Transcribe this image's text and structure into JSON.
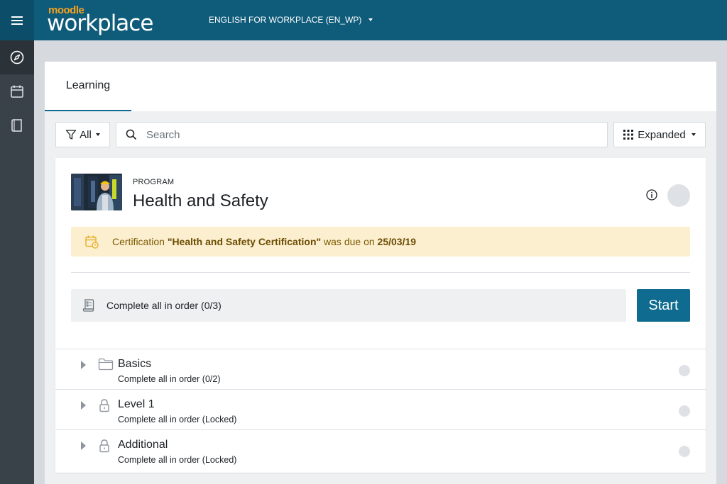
{
  "header": {
    "logo_small": "moodle",
    "logo_main": "workplace",
    "tenant": "ENGLISH FOR WORKPLACE (EN_WP)",
    "menu_icon": "hamburger-icon"
  },
  "rail": {
    "items": [
      {
        "icon": "compass-icon",
        "active": true
      },
      {
        "icon": "calendar-icon",
        "active": false
      },
      {
        "icon": "book-icon",
        "active": false
      }
    ]
  },
  "tabs": [
    {
      "label": "Learning",
      "active": true
    }
  ],
  "filters": {
    "filter_label": "All",
    "search_placeholder": "Search",
    "view_label": "Expanded"
  },
  "program": {
    "type_label": "PROGRAM",
    "title": "Health and Safety",
    "alert": {
      "prefix": "Certification ",
      "cert_name": "\"Health and Safety Certification\"",
      "middle": " was due on ",
      "date": "25/03/19",
      "color": "#fcefd0"
    },
    "completion": "Complete all in order (0/3)",
    "start_label": "Start",
    "items": [
      {
        "icon": "folder-icon",
        "title": "Basics",
        "subtitle": "Complete all in order (0/2)"
      },
      {
        "icon": "lock-icon",
        "title": "Level 1",
        "subtitle": "Complete all in order (Locked)"
      },
      {
        "icon": "lock-icon",
        "title": "Additional",
        "subtitle": "Complete all in order (Locked)"
      }
    ]
  },
  "colors": {
    "topbar": "#0f5b7a",
    "rail": "#394149",
    "primary_button": "#0f6b8f"
  }
}
